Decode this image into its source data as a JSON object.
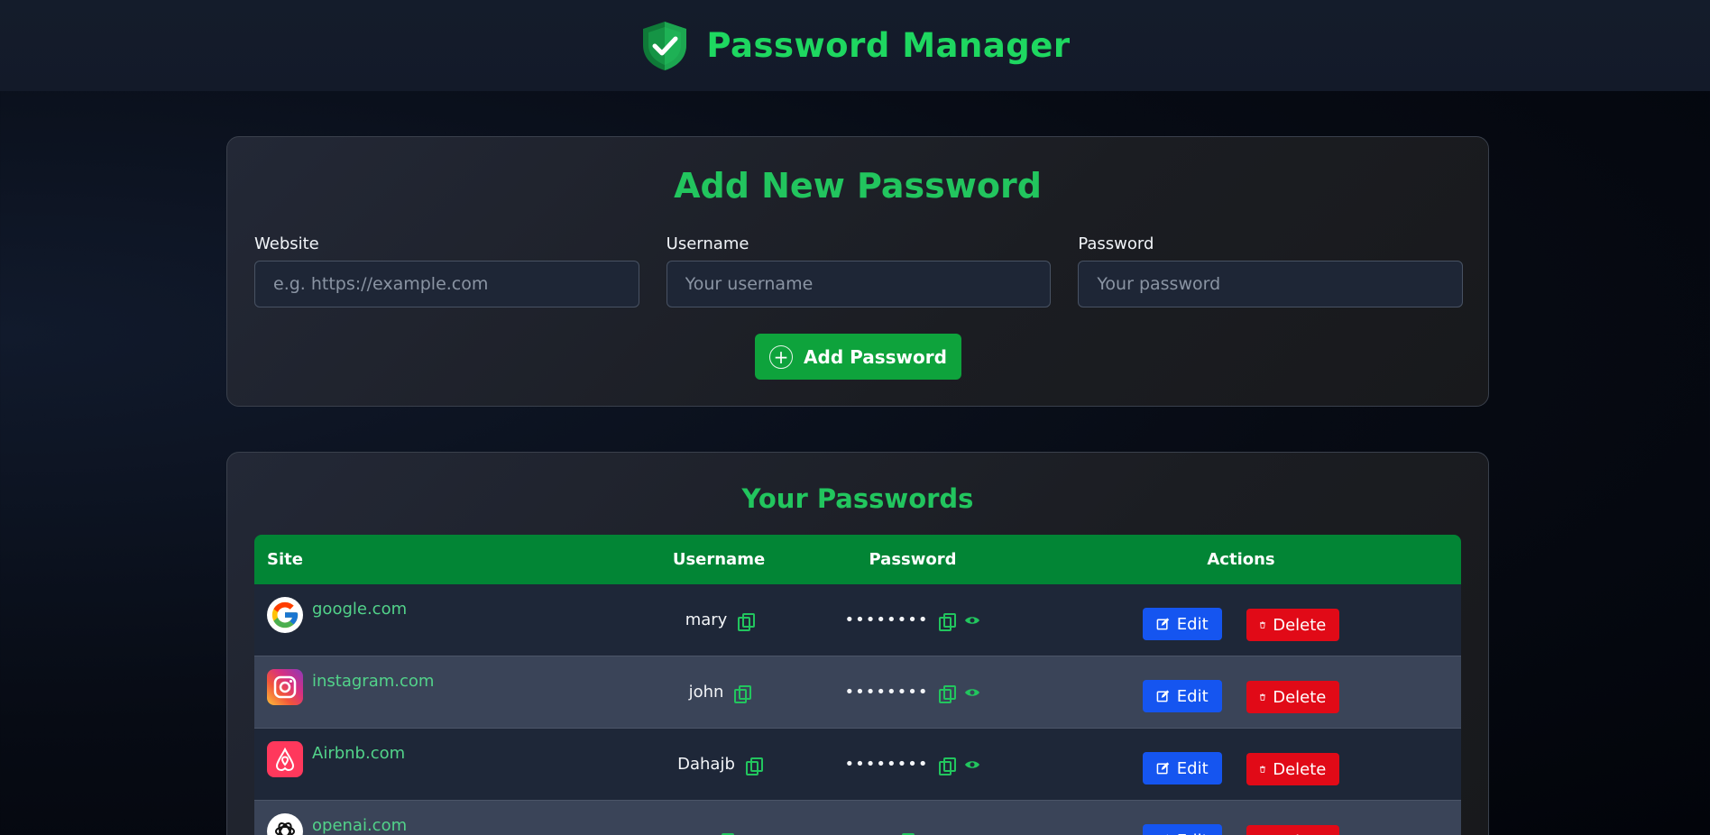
{
  "header": {
    "title": "Password Manager",
    "logo_icon": "shield-check-icon",
    "accent": "#1ed760"
  },
  "form": {
    "title": "Add New Password",
    "website_label": "Website",
    "website_placeholder": "e.g. https://example.com",
    "website_value": "",
    "username_label": "Username",
    "username_placeholder": "Your username",
    "username_value": "",
    "password_label": "Password",
    "password_placeholder": "Your password",
    "password_value": "",
    "add_button_label": "Add Password"
  },
  "list": {
    "title": "Your Passwords",
    "columns": [
      "Site",
      "Username",
      "Password",
      "Actions"
    ],
    "rows": [
      {
        "site": "google.com",
        "icon": "google-icon",
        "username": "mary",
        "password_mask": "••••••••"
      },
      {
        "site": "instagram.com",
        "icon": "instagram-icon",
        "username": "john",
        "password_mask": "••••••••"
      },
      {
        "site": "Airbnb.com",
        "icon": "airbnb-icon",
        "username": "Dahajb",
        "password_mask": "••••••••"
      },
      {
        "site": "openai.com",
        "icon": "openai-icon",
        "username": "",
        "password_mask": ""
      }
    ],
    "edit_label": "Edit",
    "delete_label": "Delete"
  },
  "colors": {
    "header_bg": "#028535",
    "edit": "#1555f0",
    "delete": "#e10a17",
    "add": "#0ea33c"
  }
}
